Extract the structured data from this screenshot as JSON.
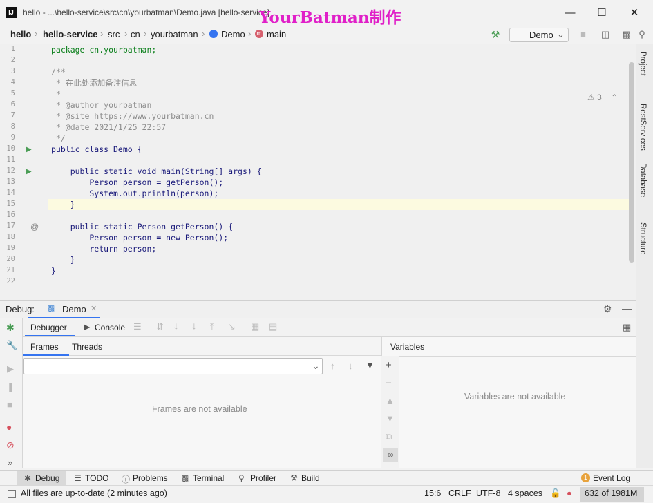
{
  "window": {
    "title": "hello - ...\\hello-service\\src\\cn\\yourbatman\\Demo.java [hello-service]",
    "watermark": "YourBatman制作",
    "logo": "IJ"
  },
  "breadcrumbs": [
    "hello",
    "hello-service",
    "src",
    "cn",
    "yourbatman",
    "Demo",
    "main"
  ],
  "run_config": "Demo",
  "inspection_count": "3",
  "code": {
    "lines": [
      {
        "n": "1",
        "text": "package cn.yourbatman;"
      },
      {
        "n": "2",
        "text": ""
      },
      {
        "n": "3",
        "text": "/**"
      },
      {
        "n": "4",
        "text": " * 在此处添加备注信息"
      },
      {
        "n": "5",
        "text": " *"
      },
      {
        "n": "6",
        "text": " * @author yourbatman"
      },
      {
        "n": "7",
        "text": " * @site https://www.yourbatman.cn"
      },
      {
        "n": "8",
        "text": " * @date 2021/1/25 22:57"
      },
      {
        "n": "9",
        "text": " */"
      },
      {
        "n": "10",
        "text": "public class Demo {"
      },
      {
        "n": "11",
        "text": ""
      },
      {
        "n": "12",
        "text": "    public static void main(String[] args) {"
      },
      {
        "n": "13",
        "text": "        Person person = getPerson();"
      },
      {
        "n": "14",
        "text": "        System.out.println(person);"
      },
      {
        "n": "15",
        "text": "    }"
      },
      {
        "n": "16",
        "text": ""
      },
      {
        "n": "17",
        "text": "    public static Person getPerson() {"
      },
      {
        "n": "18",
        "text": "        Person person = new Person();"
      },
      {
        "n": "19",
        "text": "        return person;"
      },
      {
        "n": "20",
        "text": "    }"
      },
      {
        "n": "21",
        "text": "}"
      },
      {
        "n": "22",
        "text": ""
      }
    ]
  },
  "right_tabs": [
    "Project",
    "RestServices",
    "Database",
    "Structure"
  ],
  "debug": {
    "label": "Debug:",
    "session_tab": "Demo",
    "tabs": [
      "Debugger",
      "Console"
    ],
    "frames_tabs": [
      "Frames",
      "Threads"
    ],
    "frames_placeholder": "Frames are not available",
    "variables_title": "Variables",
    "variables_placeholder": "Variables are not available"
  },
  "tool_windows": [
    "Debug",
    "TODO",
    "Problems",
    "Terminal",
    "Profiler",
    "Build"
  ],
  "event_log": "Event Log",
  "event_log_count": "1",
  "status": {
    "message": "All files are up-to-date (2 minutes ago)",
    "position": "15:6",
    "line_sep": "CRLF",
    "encoding": "UTF-8",
    "indent": "4 spaces",
    "memory": "632 of 1981M"
  },
  "colors": {
    "accent": "#3574f0",
    "watermark": "#e020c8",
    "highlight": "#fcfae0"
  }
}
